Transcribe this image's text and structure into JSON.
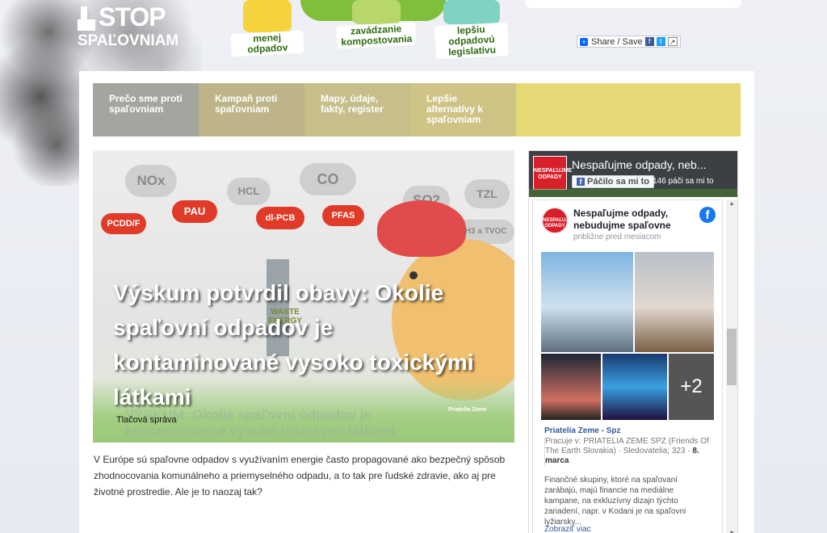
{
  "logo": {
    "line1": "STOP",
    "line2": "SPAĽOVNIAM"
  },
  "cartoons": [
    {
      "caption": "menej odpadov"
    },
    {
      "caption": "zavádzanie kompostovania"
    },
    {
      "caption": "lepšiu odpadovú legislatívu"
    }
  ],
  "share": {
    "label": "Share / Save"
  },
  "nav": [
    {
      "label": "Prečo sme proti spaľovniam"
    },
    {
      "label": "Kampaň proti spaľovniam"
    },
    {
      "label": "Mapy, údaje, fakty, register"
    },
    {
      "label": "Lepšie alternatívy k spaľovniam"
    }
  ],
  "hero": {
    "pollutants_gray": [
      "NOx",
      "HCL",
      "CO",
      "SO2",
      "TZL",
      "NH3 a TVOC"
    ],
    "pollutants_red": [
      "PCDD/F",
      "PAU",
      "dl-PCB",
      "PFAS"
    ],
    "chimney_text": "WASTE ENERGY",
    "banner_text": "VÝSKUM: Okolie spaľovní odpadov je kontaminované vysoko toxickými látkami",
    "badge": "Priatelia Zeme",
    "title": "Výskum potvrdil obavy: Okolie spaľovní odpadov je kontaminované vysoko toxickými látkami",
    "tag": "Tlačová správa"
  },
  "excerpt": "V Európe sú spaľovne odpadov s využívaním energie často propagované ako bezpečný spôsob zhodnocovania komunálneho a priemyselného odpadu, a to tak pre ľudské zdravie, ako aj pre životné prostredie. Ale je to naozaj tak?",
  "fb": {
    "page_name": "Nespaľujme odpady, neb...",
    "thumb_text": "NESPAĽUJME ODPADY",
    "like_button": "Páčilo sa mi to",
    "likes": "146 páči sa mi to",
    "post_name": "Nespaľujme odpady, nebudujme spaľovne",
    "post_time": "približne pred mesiacom",
    "more_photos": "+2",
    "author": "Priatelia Zeme - Spz",
    "author_info_prefix": "Pracuje v: PRIATELIA ZEME SPZ (Friends Of The Earth Slovakia) · Sledovatelia; 323 · ",
    "author_info_date": "8. marca",
    "post_text": "Finančné skupiny, ktoré na spaľovaní zarábajú, majú financie na mediálne kampane, na exkluzívny dizajn týchto zariadení, napr. v Kodani je na spaľovni lyžiarsky...",
    "more_link": "Zobraziť viac"
  }
}
